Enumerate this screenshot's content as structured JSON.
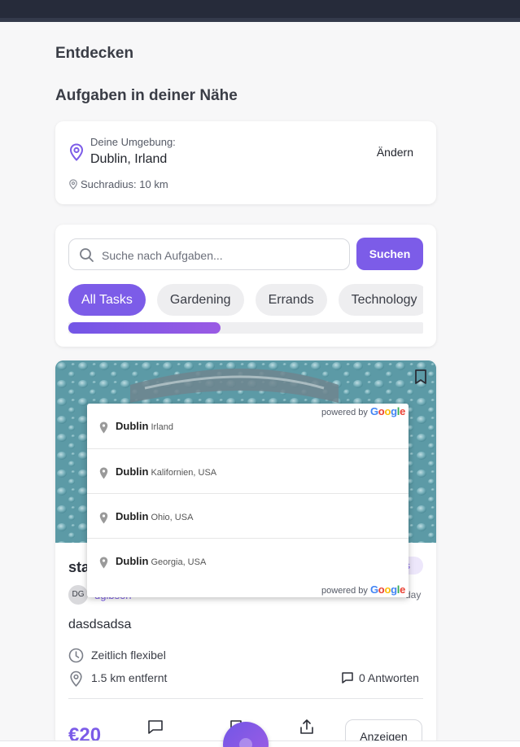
{
  "page": {
    "title": "Entdecken",
    "subtitle": "Aufgaben in deiner Nähe"
  },
  "location": {
    "label": "Deine Umgebung:",
    "city": "Dublin, Irland",
    "change_label": "Ändern",
    "radius_text": "Suchradius: 10 km"
  },
  "search": {
    "placeholder": "Suche nach Aufgaben...",
    "button_label": "Suchen"
  },
  "categories": {
    "items": [
      {
        "label": "All Tasks",
        "active": true
      },
      {
        "label": "Gardening",
        "active": false
      },
      {
        "label": "Errands",
        "active": false
      },
      {
        "label": "Technology",
        "active": false
      }
    ],
    "scroll_fraction": 0.43
  },
  "task": {
    "title_partial": "sta",
    "badge_partial": "s",
    "avatar_initials": "DG",
    "username_partial": "dgibson",
    "date_partial": "day",
    "description": "dasdsadsa",
    "time_text": "Zeitlich flexibel",
    "distance_text": "1.5 km entfernt",
    "replies_text": "0 Antworten",
    "price_partial": "€20",
    "show_button": "Anzeigen"
  },
  "autocomplete": {
    "powered_by": "powered by",
    "brand": [
      "G",
      "o",
      "o",
      "g",
      "l",
      "e"
    ],
    "items": [
      {
        "main": "Dublin",
        "secondary": "Irland"
      },
      {
        "main": "Dublin",
        "secondary": "Kalifornien, USA"
      },
      {
        "main": "Dublin",
        "secondary": "Ohio, USA"
      },
      {
        "main": "Dublin",
        "secondary": "Georgia, USA"
      }
    ]
  },
  "colors": {
    "accent": "#7c5ce8",
    "topbar": "#262b3a",
    "background": "#f7f7f8"
  }
}
